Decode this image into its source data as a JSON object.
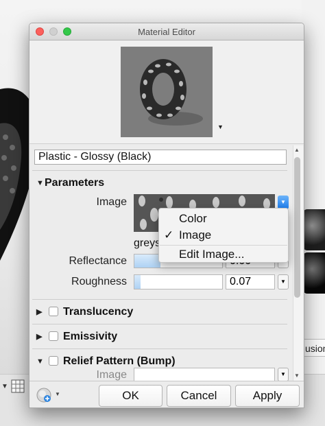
{
  "window": {
    "title": "Material Editor"
  },
  "material": {
    "name": "Plastic - Glossy (Black)"
  },
  "sections": {
    "parameters": "Parameters",
    "translucency": "Translucency",
    "emissivity": "Emissivity",
    "relief": "Relief Pattern (Bump)"
  },
  "parameters": {
    "image_label": "Image",
    "image_source_text": "greys",
    "reflectance_label": "Reflectance",
    "reflectance_value": "0.00",
    "reflectance_fraction": 0.3,
    "roughness_label": "Roughness",
    "roughness_value": "0.07",
    "roughness_fraction": 0.07
  },
  "relief": {
    "image_label": "Image"
  },
  "popup_menu": {
    "items": [
      "Color",
      "Image",
      "Edit Image..."
    ],
    "checked": "Image"
  },
  "buttons": {
    "ok": "OK",
    "cancel": "Cancel",
    "apply": "Apply"
  },
  "background": {
    "right_button_text": "usion"
  },
  "colors": {
    "accent": "#1a7df0",
    "close": "#fc605c",
    "zoom": "#34c84a"
  }
}
